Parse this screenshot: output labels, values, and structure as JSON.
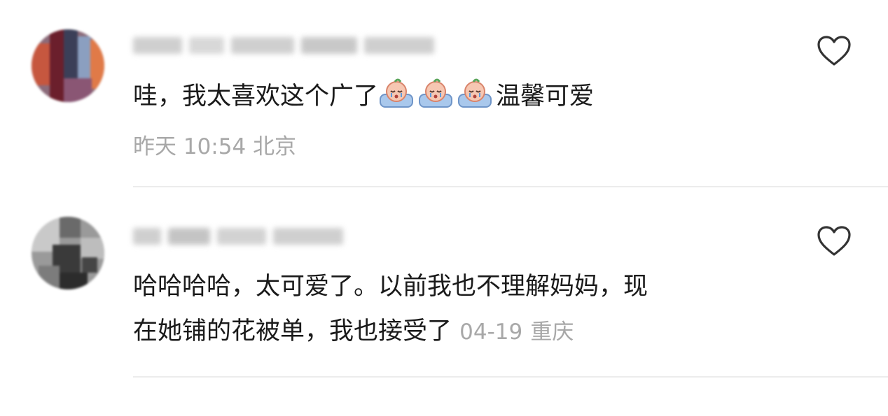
{
  "comments": [
    {
      "text_before": "哇，我太喜欢这个广了",
      "emojis": [
        "crying-baby-emoji",
        "crying-baby-emoji",
        "crying-baby-emoji"
      ],
      "text_after": "温馨可爱",
      "time": "昨天 10:54",
      "location": "北京",
      "like_icon": "heart-outline-icon"
    },
    {
      "text_line1": "哈哈哈哈，太可爱了。以前我也不理解妈妈，现",
      "text_line2": "在她铺的花被单，我也接受了",
      "date": "04-19",
      "location": "重庆",
      "like_icon": "heart-outline-icon"
    }
  ],
  "colors": {
    "text": "#1a1a1a",
    "meta": "#a8a8a8",
    "divider": "#ececec",
    "icon": "#333333"
  }
}
